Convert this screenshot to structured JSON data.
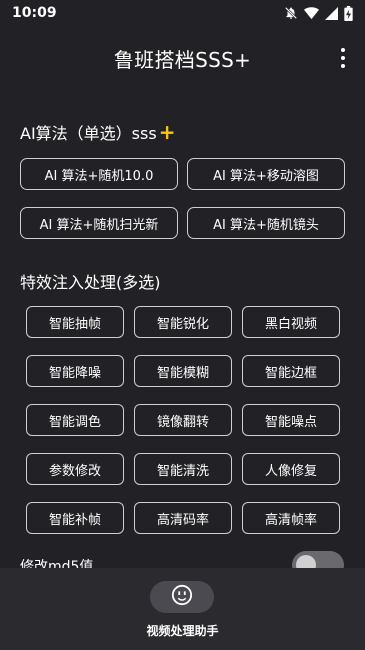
{
  "status_bar": {
    "time": "10:09",
    "icons": [
      "bell-off-icon",
      "wifi-icon",
      "signal-icon",
      "battery-charging-icon"
    ]
  },
  "app_bar": {
    "title": "鲁班搭档SSS+",
    "menu_icon": "more-vert-icon"
  },
  "algo_section": {
    "title": "AI算法（单选）sss",
    "badge": "+",
    "badge_color": "#f6c80e",
    "options": [
      "AI 算法+随机10.0",
      "AI 算法+移动溶图",
      "AI 算法+随机扫光新",
      "AI 算法+随机镜头"
    ]
  },
  "fx_section": {
    "title": "特效注入处理(多选)",
    "options": [
      "智能抽帧",
      "智能锐化",
      "黑白视频",
      "智能降噪",
      "智能模糊",
      "智能边框",
      "智能调色",
      "镜像翻转",
      "智能噪点",
      "参数修改",
      "智能清洗",
      "人像修复",
      "智能补帧",
      "高清码率",
      "高清帧率"
    ]
  },
  "md5": {
    "label": "修改md5值",
    "enabled": false
  },
  "bottom_nav": {
    "icon": "smiley-face-icon",
    "label": "视频处理助手"
  }
}
